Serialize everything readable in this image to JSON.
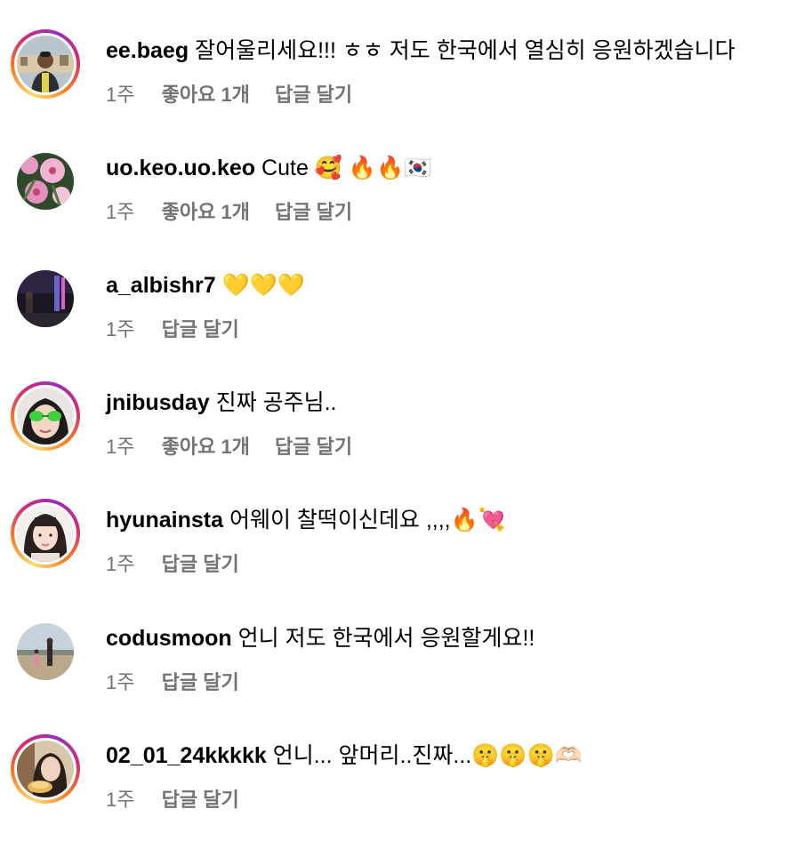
{
  "comments": [
    {
      "username": "ee.baeg",
      "text": "잘어울리세요!!! ㅎㅎ 저도 한국에서 열심히 응원하겠습니다",
      "time": "1주",
      "likes": "좋아요 1개",
      "reply": "답글 달기",
      "has_story": true,
      "avatar": "man-portrait-avatar"
    },
    {
      "username": "uo.keo.uo.keo",
      "text": "Cute 🥰 🔥🔥🇰🇷",
      "time": "1주",
      "likes": "좋아요 1개",
      "reply": "답글 달기",
      "has_story": false,
      "avatar": "lily-flowers-avatar"
    },
    {
      "username": "a_albishr7",
      "text": "💛💛💛",
      "time": "1주",
      "likes": "",
      "reply": "답글 달기",
      "has_story": false,
      "avatar": "night-street-avatar"
    },
    {
      "username": "jnibusday",
      "text": "진짜 공주님..",
      "time": "1주",
      "likes": "좋아요 1개",
      "reply": "답글 달기",
      "has_story": true,
      "avatar": "woman-green-glasses-avatar"
    },
    {
      "username": "hyunainsta",
      "text": "어웨이 찰떡이신데요 ,,,,🔥💘",
      "time": "1주",
      "likes": "",
      "reply": "답글 달기",
      "has_story": true,
      "avatar": "woman-portrait-avatar"
    },
    {
      "username": "codusmoon",
      "text": "언니 저도 한국에서 응원할게요!!",
      "time": "1주",
      "likes": "",
      "reply": "답글 달기",
      "has_story": false,
      "avatar": "field-couple-avatar"
    },
    {
      "username": "02_01_24kkkkk",
      "text": "언니... 앞머리..진짜...🤫🤫🤫🫶🏻",
      "time": "1주",
      "likes": "",
      "reply": "답글 달기",
      "has_story": true,
      "avatar": "woman-food-avatar"
    }
  ],
  "colors": {
    "text": "#000000",
    "meta": "#737373",
    "story_ring": [
      "#feda75",
      "#fa7e1e",
      "#d62976",
      "#962fbf"
    ]
  }
}
